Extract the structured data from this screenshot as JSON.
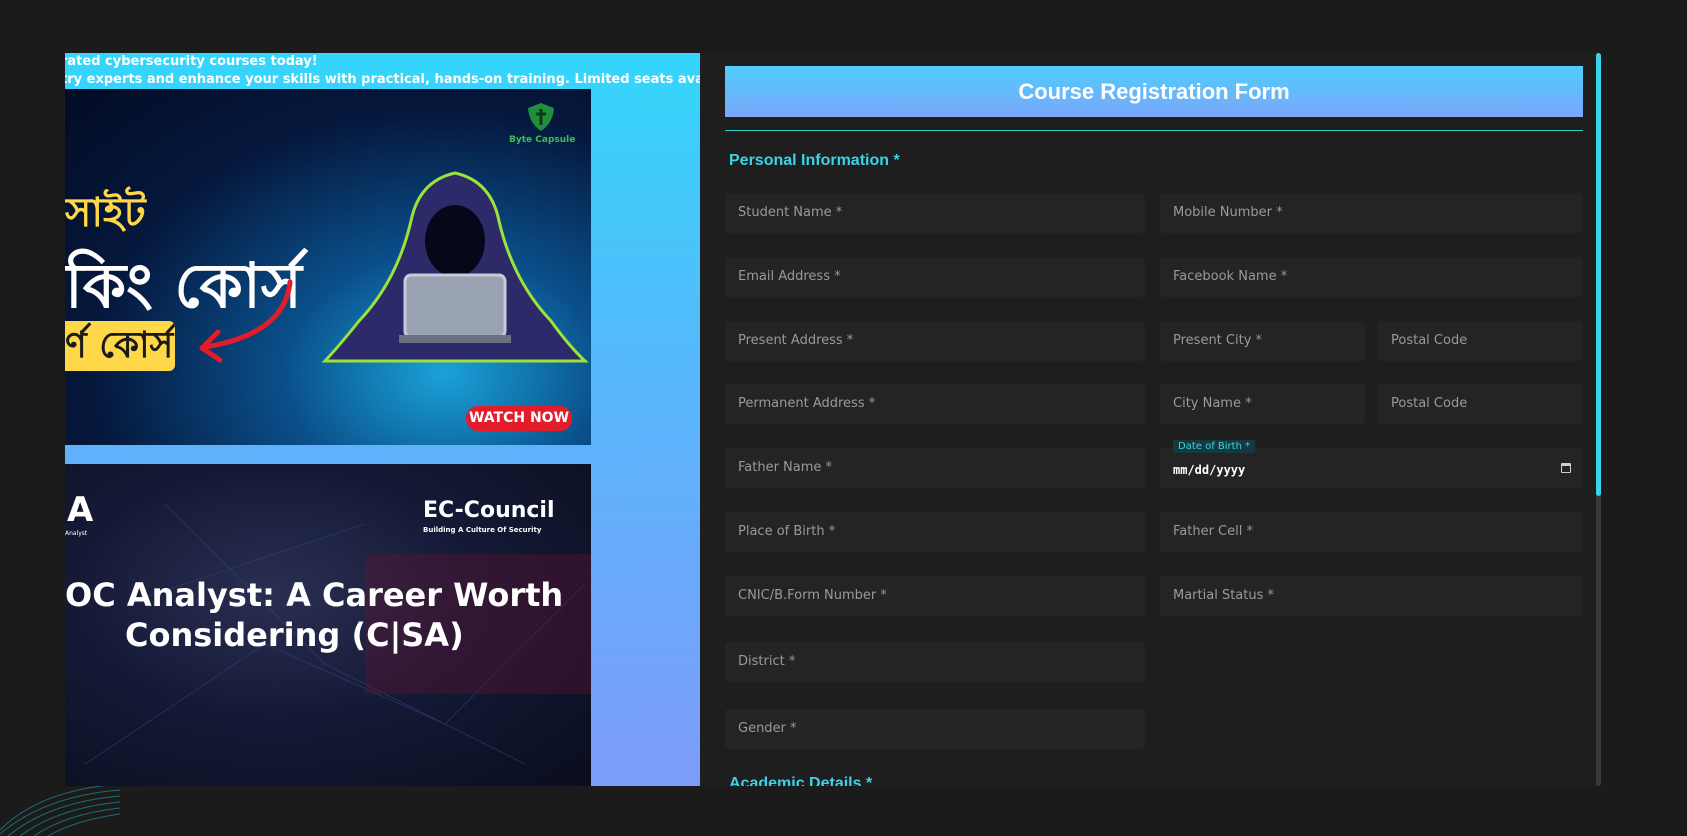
{
  "promo": {
    "ticker_line1": "rated cybersecurity courses today!",
    "ticker_line2": "try experts and enhance your skills with practical, hands-on training. Limited seats available - sign u",
    "banner1": {
      "brand": "Byte Capsule",
      "line1": "সাইট",
      "line2": "কিং কোর্স",
      "pill": "র্ণ কোর্স",
      "cta": "WATCH NOW"
    },
    "banner2": {
      "corner_letter": "A",
      "corner_small": "Analyst",
      "brand": "EC-Council",
      "brand_tagline": "Building A Culture Of Security",
      "headline1": "OC Analyst: A Career Worth",
      "headline2": "Considering (C|SA)"
    }
  },
  "form": {
    "title": "Course Registration Form",
    "section_personal": "Personal Information *",
    "section_academic": "Academic Details *",
    "fields": {
      "student_name": "Student Name *",
      "mobile_number": "Mobile Number *",
      "email": "Email Address *",
      "facebook": "Facebook Name *",
      "present_address": "Present Address *",
      "present_city": "Present City *",
      "present_postal": "Postal Code",
      "permanent_address": "Permanent Address *",
      "city_name": "City Name *",
      "permanent_postal": "Postal Code",
      "father_name": "Father Name *",
      "dob_label": "Date of Birth *",
      "dob_value": "mm/dd/yyyy",
      "place_of_birth": "Place of Birth *",
      "father_cell": "Father Cell *",
      "cnic": "CNIC/B.Form Number *",
      "marital_status": "Martial Status *",
      "district": "District *",
      "gender": "Gender *"
    }
  },
  "colors": {
    "accent": "#3ad3e8",
    "background": "#1b1b1b",
    "field_bg": "#242424",
    "cta_red": "#e21c2a"
  }
}
